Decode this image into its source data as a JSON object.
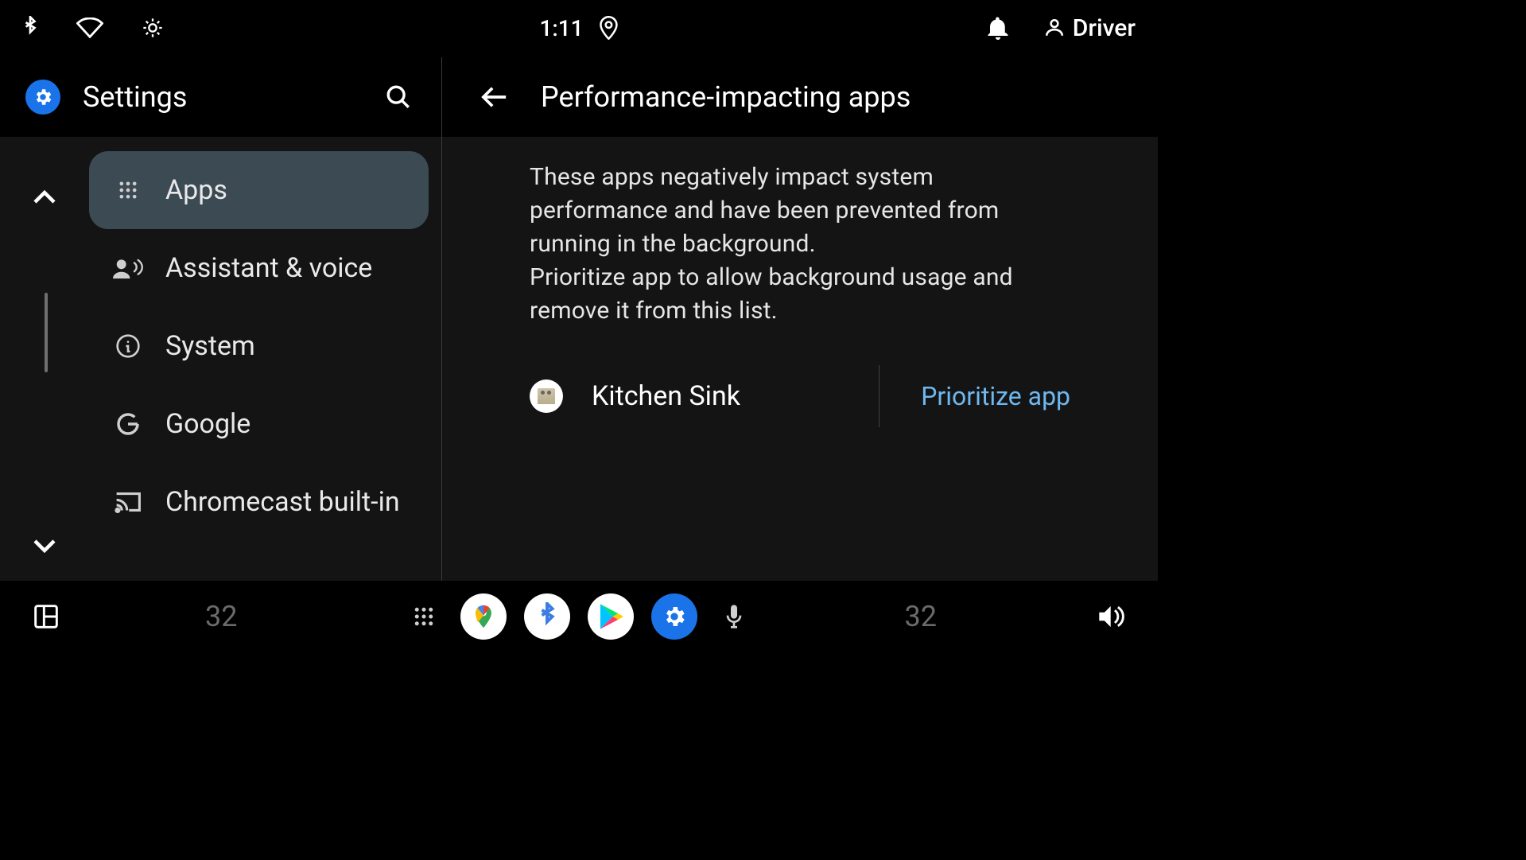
{
  "status": {
    "time": "1:11",
    "user_label": "Driver"
  },
  "sidebar": {
    "title": "Settings",
    "items": [
      {
        "label": "Apps",
        "icon": "apps-grid-icon",
        "active": true
      },
      {
        "label": "Assistant & voice",
        "icon": "assistant-voice-icon",
        "active": false
      },
      {
        "label": "System",
        "icon": "info-icon",
        "active": false
      },
      {
        "label": "Google",
        "icon": "google-g-icon",
        "active": false
      },
      {
        "label": "Chromecast built-in",
        "icon": "cast-icon",
        "active": false
      }
    ]
  },
  "detail": {
    "title": "Performance-impacting apps",
    "description_line1": "These apps negatively impact system performance and have been prevented from running in the background.",
    "description_line2": "Prioritize app to allow background usage and remove it from this list.",
    "apps": [
      {
        "name": "Kitchen Sink",
        "action_label": "Prioritize app"
      }
    ]
  },
  "bottombar": {
    "temp_left": "32",
    "temp_right": "32"
  },
  "colors": {
    "accent": "#1a73e8",
    "link": "#6fb8ef",
    "panel": "#141414",
    "active_item": "#3c4a54"
  }
}
